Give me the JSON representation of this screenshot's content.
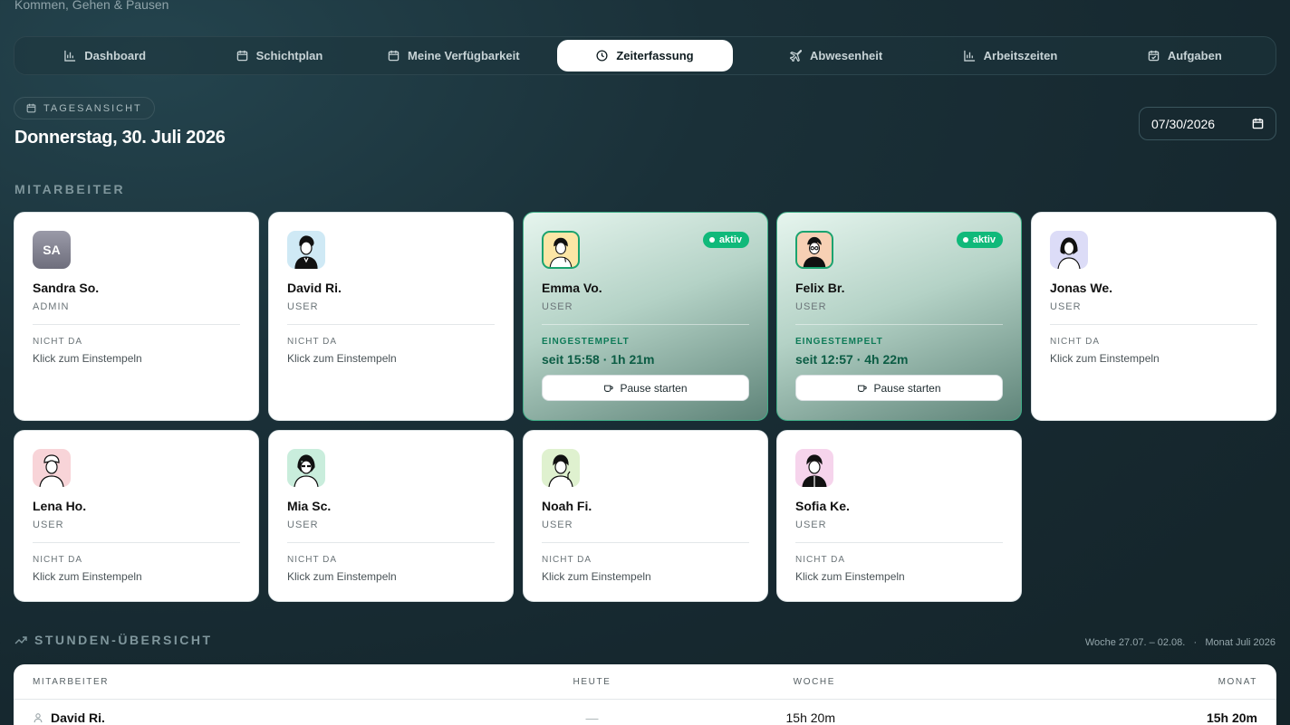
{
  "header": {
    "subtitle": "Kommen, Gehen & Pausen"
  },
  "tabs": [
    {
      "label": "Dashboard",
      "icon": "bar-chart-icon"
    },
    {
      "label": "Schichtplan",
      "icon": "calendar-icon"
    },
    {
      "label": "Meine Verfügbarkeit",
      "icon": "calendar-icon"
    },
    {
      "label": "Zeiterfassung",
      "icon": "clock-icon",
      "active": true
    },
    {
      "label": "Abwesenheit",
      "icon": "plane-icon"
    },
    {
      "label": "Arbeitszeiten",
      "icon": "bar-chart-icon"
    },
    {
      "label": "Aufgaben",
      "icon": "calendar-check-icon"
    }
  ],
  "view": {
    "chip": "TAGESANSICHT",
    "date_title": "Donnerstag, 30. Juli 2026",
    "date_value": "07/30/2026"
  },
  "section_employees": "MITARBEITER",
  "employees": [
    {
      "name": "Sandra So.",
      "role": "ADMIN",
      "initials": "SA",
      "status": "NICHT DA",
      "hint": "Klick zum Einstempeln",
      "active": false
    },
    {
      "name": "David Ri.",
      "role": "USER",
      "status": "NICHT DA",
      "hint": "Klick zum Einstempeln",
      "active": false,
      "avatar_bg": "#cfe9f5"
    },
    {
      "name": "Emma Vo.",
      "role": "USER",
      "status": "EINGESTEMPELT",
      "since": "seit 15:58 · 1h 21m",
      "active": true,
      "badge": "aktiv",
      "button": "Pause starten",
      "avatar_bg": "#fbe6a6"
    },
    {
      "name": "Felix Br.",
      "role": "USER",
      "status": "EINGESTEMPELT",
      "since": "seit 12:57 · 4h 22m",
      "active": true,
      "badge": "aktiv",
      "button": "Pause starten",
      "avatar_bg": "#f7d0b4"
    },
    {
      "name": "Jonas We.",
      "role": "USER",
      "status": "NICHT DA",
      "hint": "Klick zum Einstempeln",
      "active": false,
      "avatar_bg": "#dcdcf7"
    },
    {
      "name": "Lena Ho.",
      "role": "USER",
      "status": "NICHT DA",
      "hint": "Klick zum Einstempeln",
      "active": false,
      "avatar_bg": "#f8d4d8"
    },
    {
      "name": "Mia Sc.",
      "role": "USER",
      "status": "NICHT DA",
      "hint": "Klick zum Einstempeln",
      "active": false,
      "avatar_bg": "#c9eddc"
    },
    {
      "name": "Noah Fi.",
      "role": "USER",
      "status": "NICHT DA",
      "hint": "Klick zum Einstempeln",
      "active": false,
      "avatar_bg": "#dff1cf"
    },
    {
      "name": "Sofia Ke.",
      "role": "USER",
      "status": "NICHT DA",
      "hint": "Klick zum Einstempeln",
      "active": false,
      "avatar_bg": "#f6d4ec"
    }
  ],
  "hours": {
    "title": "STUNDEN-ÜBERSICHT",
    "period": "Woche 27.07. – 02.08.   ·   Monat Juli 2026",
    "columns": [
      "MITARBEITER",
      "HEUTE",
      "WOCHE",
      "MONAT"
    ],
    "rows": [
      {
        "name": "David Ri.",
        "today": "—",
        "week": "15h 20m",
        "month": "15h 20m"
      }
    ]
  },
  "colors": {
    "accent_green": "#10b97a",
    "background": "#16282f"
  }
}
